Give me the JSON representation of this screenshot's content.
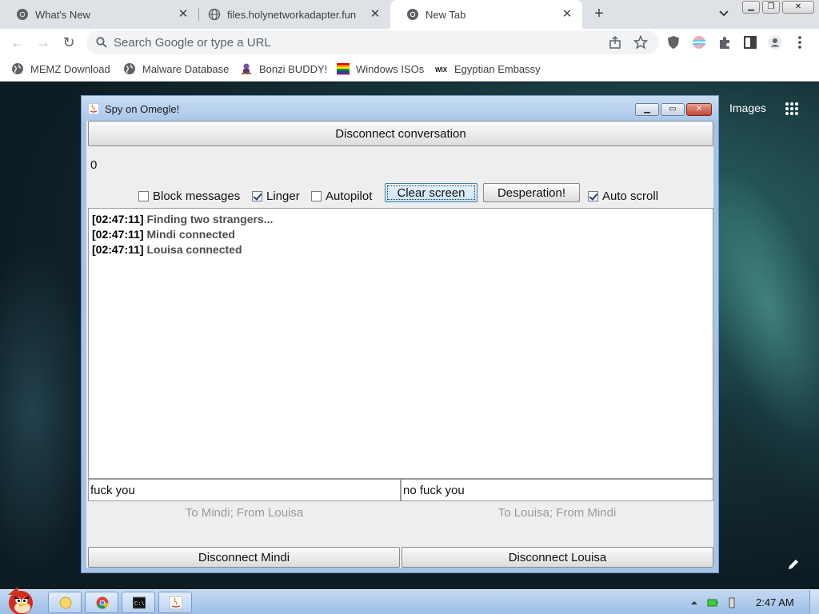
{
  "browser": {
    "tabs": [
      {
        "title": "What's New",
        "active": false
      },
      {
        "title": "files.holynetworkadapter.fun",
        "active": false
      },
      {
        "title": "New Tab",
        "active": true
      }
    ],
    "omnibox": {
      "placeholder": "Search Google or type a URL"
    },
    "bookmarks": [
      {
        "label": "MEMZ Download",
        "icon": "globe-icon"
      },
      {
        "label": "Malware Database",
        "icon": "globe-icon"
      },
      {
        "label": "Bonzi BUDDY!",
        "icon": "bonzi-icon"
      },
      {
        "label": "Windows ISOs",
        "icon": "rainbow-flag-icon"
      },
      {
        "label": "Egyptian Embassy",
        "icon": "wix-icon"
      }
    ],
    "newtab": {
      "images_link": "Images"
    }
  },
  "app": {
    "title": "Spy on Omegle!",
    "disconnect_conversation": "Disconnect conversation",
    "counter": "0",
    "options": [
      {
        "label": "Block messages",
        "checked": false
      },
      {
        "label": "Linger",
        "checked": true
      },
      {
        "label": "Autopilot",
        "checked": false
      }
    ],
    "clear_screen": "Clear screen",
    "desperation": "Desperation!",
    "auto_scroll": {
      "label": "Auto scroll",
      "checked": true
    },
    "log": [
      {
        "time": "[02:47:11]",
        "text": "Finding two strangers..."
      },
      {
        "time": "[02:47:11]",
        "text": "Mindi connected"
      },
      {
        "time": "[02:47:11]",
        "text": "Louisa connected"
      }
    ],
    "left_input": {
      "value": "fuck you",
      "route": "To Mindi; From Louisa"
    },
    "right_input": {
      "value": "no fuck you",
      "route": "To Louisa; From Mindi"
    },
    "disconnect_left": "Disconnect Mindi",
    "disconnect_right": "Disconnect Louisa"
  },
  "taskbar": {
    "clock": "2:47 AM"
  }
}
